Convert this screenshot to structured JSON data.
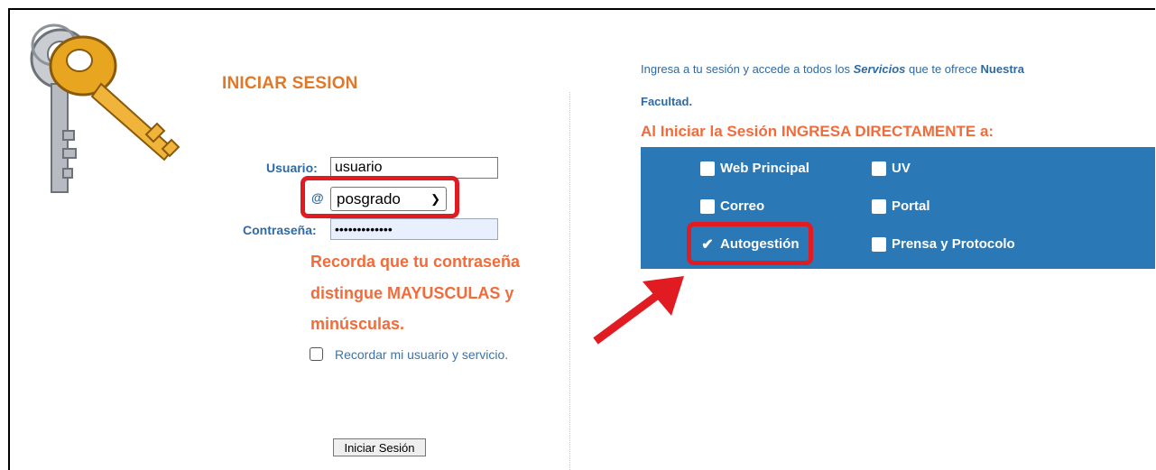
{
  "login": {
    "title": "INICIAR SESION",
    "user_label": "Usuario:",
    "user_value": "usuario",
    "domain_at": "@",
    "domain_value": "posgrado",
    "password_label": "Contraseña:",
    "password_value": "•••••••••••••",
    "warning_line1": "Recorda que tu contraseña",
    "warning_line2": "distingue MAYUSCULAS y",
    "warning_line3": "minúsculas.",
    "remember_label": "Recordar mi usuario y servicio.",
    "remember_checked": false,
    "submit_label": "Iniciar Sesión"
  },
  "info": {
    "line1_pre": "Ingresa a tu sesión y accede a todos los ",
    "line1_em": "Servicios",
    "line1_mid": " que te ofrece ",
    "line1_strong": "Nuestra",
    "line2": "Facultad.",
    "heading": "Al Iniciar la Sesión INGRESA DIRECTAMENTE a:"
  },
  "services": [
    {
      "label": "Web Principal",
      "checked": false
    },
    {
      "label": "UV",
      "checked": false
    },
    {
      "label": "Correo",
      "checked": false
    },
    {
      "label": "Portal",
      "checked": false
    },
    {
      "label": "Autogestión",
      "checked": true
    },
    {
      "label": "Prensa y Protocolo",
      "checked": false
    }
  ],
  "colors": {
    "accent_orange": "#f26b3a",
    "label_blue": "#2e6aa3",
    "panel_blue": "#2b78b6",
    "highlight_red": "#e11b22"
  },
  "icons": {
    "keys": "keys-icon",
    "annotation_arrow": "red-arrow-icon"
  }
}
